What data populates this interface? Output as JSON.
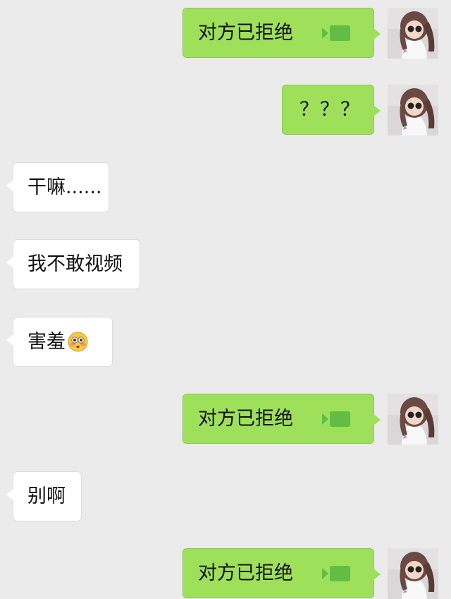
{
  "messages": [
    {
      "side": "outgoing",
      "text": "对方已拒绝",
      "icon": "video-call-icon"
    },
    {
      "side": "outgoing",
      "text": "？？？"
    },
    {
      "side": "incoming",
      "text": "干嘛......"
    },
    {
      "side": "incoming",
      "text": "我不敢视频"
    },
    {
      "side": "incoming",
      "text": "害羞",
      "icon": "flushed-face-icon"
    },
    {
      "side": "outgoing",
      "text": "对方已拒绝",
      "icon": "video-call-icon"
    },
    {
      "side": "incoming",
      "text": "别啊"
    },
    {
      "side": "outgoing",
      "text": "对方已拒绝",
      "icon": "video-call-icon"
    }
  ],
  "colors": {
    "background": "#ebebeb",
    "outgoing_bubble": "#9ee05a",
    "incoming_bubble": "#ffffff",
    "video_icon": "#62bd46"
  }
}
